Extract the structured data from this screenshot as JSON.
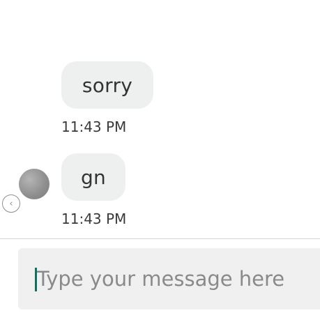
{
  "messages": [
    {
      "text": "sorry",
      "time": "11:43 PM"
    },
    {
      "text": "gn",
      "time": "11:43 PM"
    }
  ],
  "composer": {
    "placeholder": "Type your message here",
    "value": ""
  },
  "icons": {
    "avatar": "user-avatar",
    "nav": "chevron-left-icon"
  },
  "colors": {
    "bubble": "#eeefef",
    "cursor": "#1d6b5c",
    "composer_bg": "#f0f0f0"
  }
}
